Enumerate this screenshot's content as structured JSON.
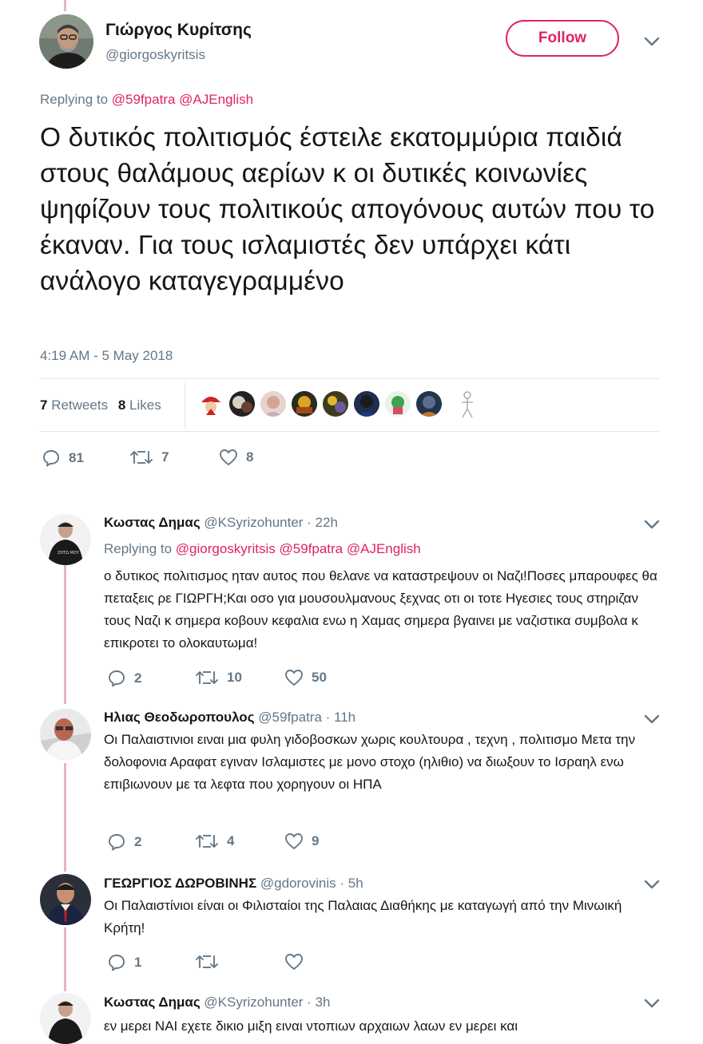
{
  "main_tweet": {
    "author_name": "Γιώργος Κυρίτσης",
    "author_handle": "@giorgoskyritsis",
    "follow_label": "Follow",
    "replying_label": "Replying to",
    "replying_to": [
      "@59fpatra",
      "@AJEnglish"
    ],
    "text": "Ο δυτικός πολιτισμός έστειλε εκατομμύρια παιδιά στους θαλάμους αερίων κ οι δυτικές κοινωνίες ψηφίζουν τους πολιτικούς απογόνους αυτών που το έκαναν. Για τους ισλαμιστές δεν υπάρχει κάτι ανάλογο καταγεγραμμένο",
    "timestamp": "4:19 AM - 5 May 2018",
    "retweets_count": "7",
    "retweets_label": "Retweets",
    "likes_count": "8",
    "likes_label": "Likes",
    "actions": {
      "replies": "81",
      "retweets": "7",
      "likes": "8"
    }
  },
  "replies": [
    {
      "author_name": "Κωστας Δημας",
      "author_handle": "@KSyrizohunter",
      "time": "22h",
      "replying_label": "Replying to",
      "replying_to": [
        "@giorgoskyritsis",
        "@59fpatra",
        "@AJEnglish"
      ],
      "text": "ο δυτικος πολιτισμος ηταν αυτος που θελανε να καταστρεψουν οι Ναζι!Ποσες μπαρουφες θα πεταξεις ρε ΓΙΩΡΓΗ;Και οσο για μουσουλμανους ξεχνας οτι οι τοτε Ηγεσιες τους στηριζαν τους Ναζι κ σημερα κοβουν κεφαλια ενω η Χαμας σημερα βγαινει με ναζιστικα συμβολα κ επικροτει το ολοκαυτωμα!",
      "actions": {
        "replies": "2",
        "retweets": "10",
        "likes": "50"
      }
    },
    {
      "author_name": "Ηλιας Θεοδωροπουλος",
      "author_handle": "@59fpatra",
      "time": "11h",
      "text": "Οι Παλαιστινιοι ειναι μια φυλη γιδοβοσκων χωρις κουλτουρα , τεχνη , πολιτισμο Μετα την δολοφονια Αραφατ εγιναν Ισλαμιστες με μονο στοχο (ηλιθιο) να διωξουν το Ισραηλ ενω επιβιωνουν με τα λεφτα που χορηγουν οι ΗΠΑ",
      "actions": {
        "replies": "2",
        "retweets": "4",
        "likes": "9"
      }
    },
    {
      "author_name": "ΓΕΩΡΓΙΟΣ ΔΩΡΟΒΙΝΗΣ",
      "author_handle": "@gdorovinis",
      "time": "5h",
      "text": "Οι Παλαιστίνιοι είναι οι Φιλισταίοι της Παλαιας Διαθήκης με καταγωγή από την Μινωική Κρήτη!",
      "actions": {
        "replies": "1",
        "retweets": "",
        "likes": ""
      }
    },
    {
      "author_name": "Κωστας Δημας",
      "author_handle": "@KSyrizohunter",
      "time": "3h",
      "text": "εν μερει ΝΑΙ εχετε δικιο μιξη ειναι ντοπιων αρχαιων λαων εν μερει και"
    }
  ],
  "time_separator": " · ",
  "colors": {
    "accent": "#e0245e",
    "muted": "#657786",
    "thread": "#e6b6c5"
  }
}
